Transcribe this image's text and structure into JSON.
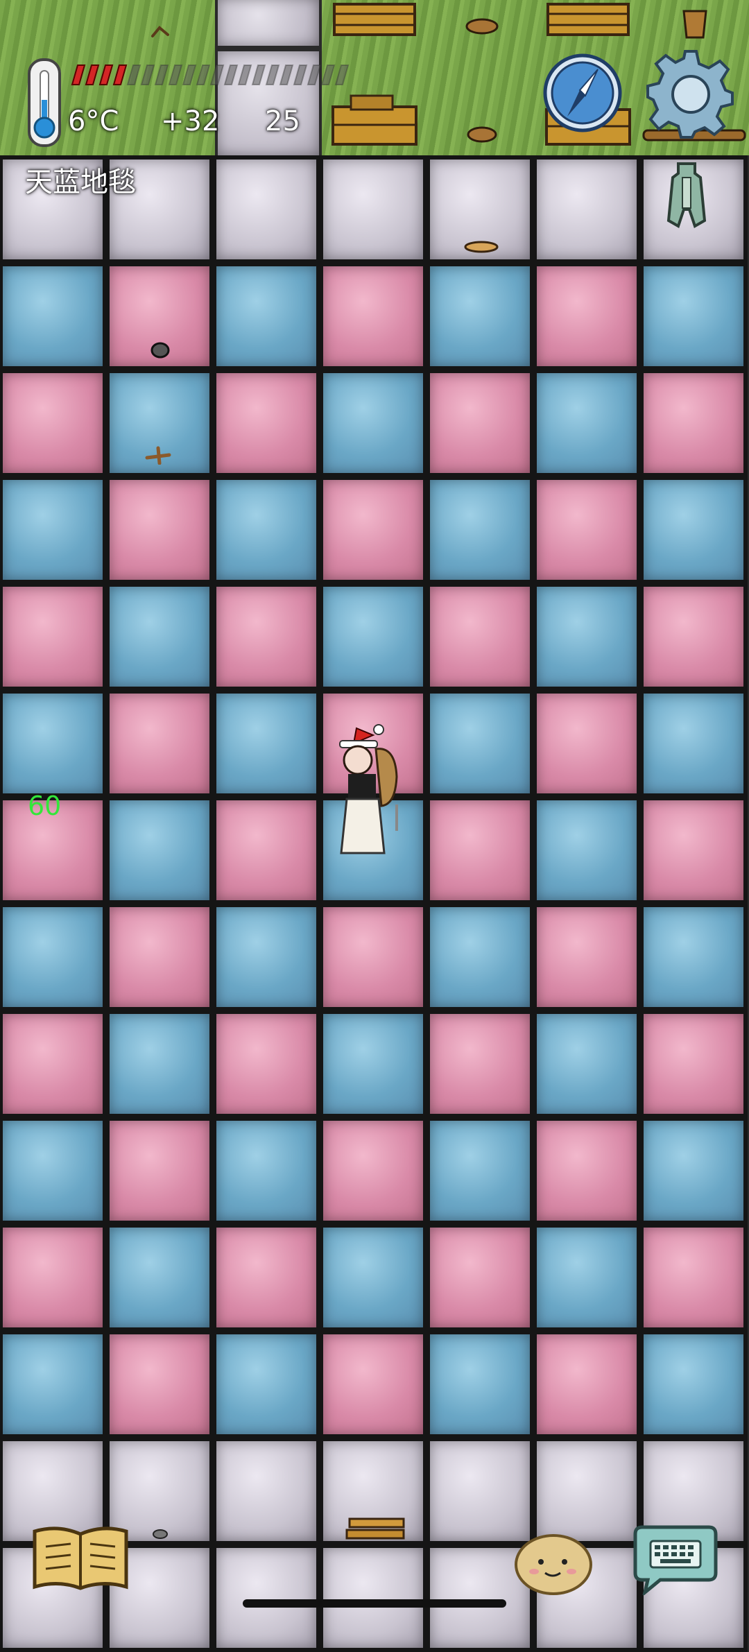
{
  "hud": {
    "temperature": "6°C",
    "yum_bonus": "+32",
    "age": "25",
    "hover_label": "天蓝地毯",
    "age_counter": "60",
    "food_pips_filled": 4,
    "food_pips_total": 20
  },
  "icons": {
    "thermometer": "thermometer-icon",
    "compass": "compass-icon",
    "settings": "gear-icon",
    "tool": "spade-icon",
    "book": "book-icon",
    "emote": "emote-face-icon",
    "keyboard": "keyboard-icon"
  },
  "colors": {
    "blue_carpet": "#6aa7c6",
    "pink_carpet": "#d98aa8",
    "stone_floor": "#c9c4d0",
    "grass": "#7aa64a",
    "food_bar_red": "#d42626",
    "age_counter_green": "#34e63a"
  }
}
